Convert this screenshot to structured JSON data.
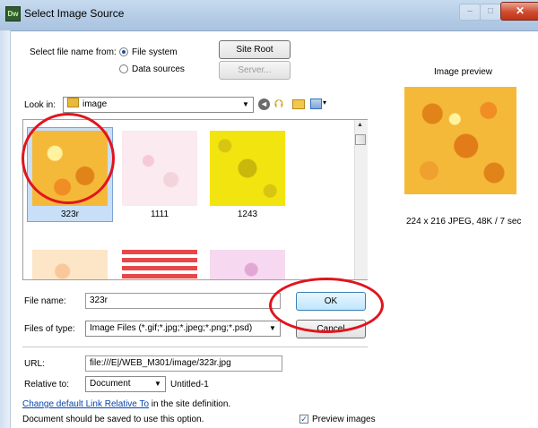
{
  "window": {
    "title": "Select Image Source",
    "app_logo": "Dw",
    "close_glyph": "✕",
    "minimize_glyph": "–",
    "maximize_glyph": "□"
  },
  "source": {
    "label": "Select file name from:",
    "options": [
      {
        "label": "File system",
        "selected": true
      },
      {
        "label": "Data sources",
        "selected": false
      }
    ],
    "site_root_button": "Site Root",
    "server_button": "Server..."
  },
  "lookin": {
    "label": "Look in:",
    "folder": "image",
    "toolbar_icons": [
      "back-icon",
      "up-folder-icon",
      "new-folder-icon",
      "view-menu-icon"
    ]
  },
  "files": [
    {
      "name": "323r",
      "selected": true,
      "swatch": "#f5b93a"
    },
    {
      "name": "1111",
      "selected": false,
      "swatch": "#fbeaf0"
    },
    {
      "name": "1243",
      "selected": false,
      "swatch": "#f2e40f"
    },
    {
      "name": "",
      "selected": false,
      "swatch": "#fde5c7"
    },
    {
      "name": "",
      "selected": false,
      "swatch": "#e8474a"
    },
    {
      "name": "",
      "selected": false,
      "swatch": "#f6d9f0"
    }
  ],
  "filename": {
    "label": "File name:",
    "value": "323r",
    "ok_button": "OK"
  },
  "filetype": {
    "label": "Files of type:",
    "value": "Image Files (*.gif;*.jpg;*.jpeg;*.png;*.psd)",
    "cancel_button": "Cancel"
  },
  "url": {
    "label": "URL:",
    "value": "file:///E|/WEB_M301/image/323r.jpg"
  },
  "relative": {
    "label": "Relative to:",
    "value": "Document",
    "doc_name": "Untitled-1"
  },
  "notes": {
    "link_text": "Change default Link Relative To",
    "link_suffix": " in the site definition.",
    "warning": "Document should be saved to use this option."
  },
  "preview": {
    "title": "Image preview",
    "info": "224 x 216 JPEG, 48K / 7 sec",
    "checkbox_label": "Preview images",
    "checked": true,
    "swatch": "#f5b93a"
  },
  "colors": {
    "selection": "#c7dff7",
    "annotation_red": "#e2141c",
    "link": "#0645ad"
  }
}
